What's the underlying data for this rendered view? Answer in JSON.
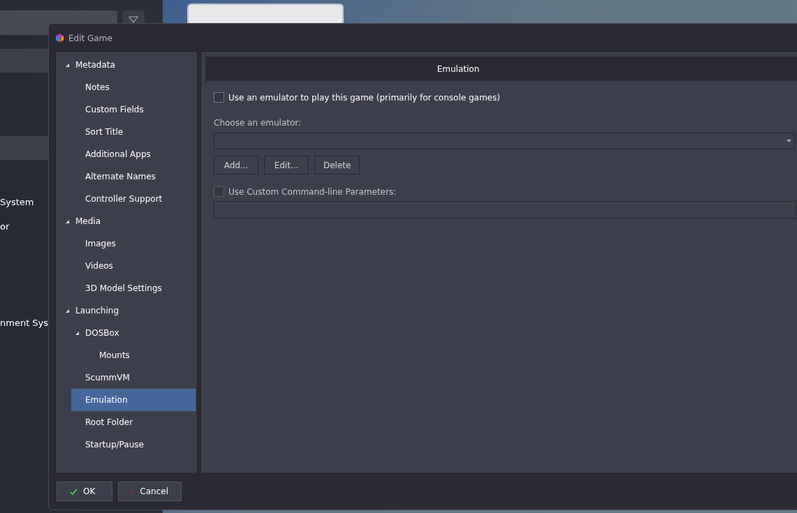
{
  "background_app": {
    "list_items": [
      "System",
      "or",
      "nment Sys"
    ]
  },
  "dialog": {
    "title": "Edit Game",
    "tree": [
      {
        "label": "Metadata",
        "expanded": true,
        "selected": false,
        "children": [
          {
            "label": "Notes",
            "selected": false
          },
          {
            "label": "Custom Fields",
            "selected": false
          },
          {
            "label": "Sort Title",
            "selected": false
          },
          {
            "label": "Additional Apps",
            "selected": false
          },
          {
            "label": "Alternate Names",
            "selected": false
          },
          {
            "label": "Controller Support",
            "selected": false
          }
        ]
      },
      {
        "label": "Media",
        "expanded": true,
        "selected": false,
        "children": [
          {
            "label": "Images",
            "selected": false
          },
          {
            "label": "Videos",
            "selected": false
          },
          {
            "label": "3D Model Settings",
            "selected": false
          }
        ]
      },
      {
        "label": "Launching",
        "expanded": true,
        "selected": false,
        "children": [
          {
            "label": "DOSBox",
            "expanded": true,
            "selected": false,
            "children": [
              {
                "label": "Mounts",
                "selected": false
              }
            ]
          },
          {
            "label": "ScummVM",
            "selected": false
          },
          {
            "label": "Emulation",
            "selected": true
          },
          {
            "label": "Root Folder",
            "selected": false
          },
          {
            "label": "Startup/Pause",
            "selected": false
          }
        ]
      }
    ],
    "panel": {
      "header": "Emulation",
      "use_emulator": {
        "label": "Use an emulator to play this game (primarily for console games)",
        "checked": false
      },
      "emulator_label": "Choose an emulator:",
      "buttons": [
        "Add...",
        "Edit...",
        "Delete"
      ],
      "use_custom_params": {
        "label": "Use Custom Command-line Parameters:",
        "checked": false
      }
    },
    "footer": [
      {
        "kind": "ok",
        "label": "OK"
      },
      {
        "kind": "cancel",
        "label": "Cancel"
      }
    ]
  }
}
